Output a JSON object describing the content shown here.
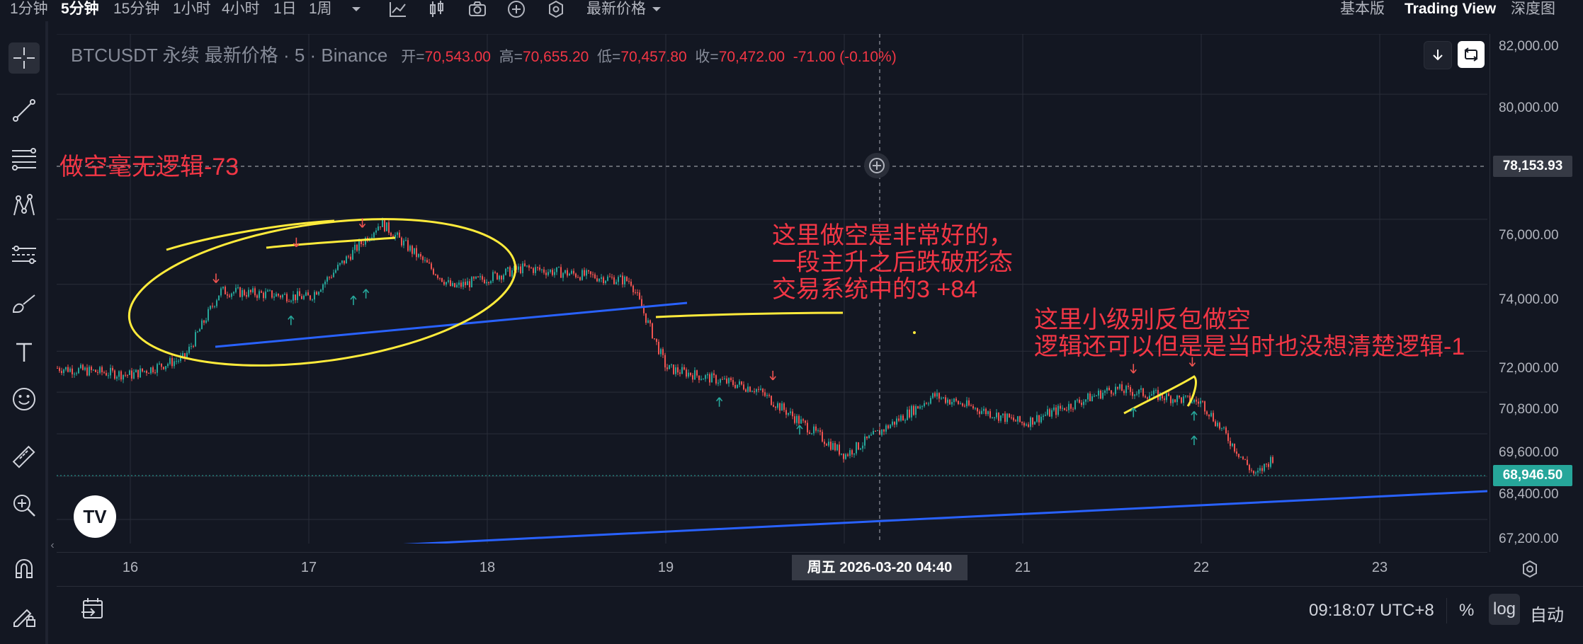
{
  "toolbar": {
    "intervals": [
      "1分钟",
      "5分钟",
      "15分钟",
      "1小时",
      "4小时",
      "1日",
      "1周"
    ],
    "active_interval": "5分钟",
    "price_type": "最新价格",
    "right_items": [
      "基本版",
      "Trading View",
      "深度图"
    ],
    "icons": [
      "chevron-down-icon",
      "indicators-icon",
      "candle-type-icon",
      "camera-icon",
      "add-icon",
      "settings-icon"
    ]
  },
  "left_tools": [
    "crosshair-icon",
    "trendline-icon",
    "fib-icon",
    "pattern-icon",
    "forecast-icon",
    "brush-icon",
    "text-icon",
    "emoji-icon",
    "ruler-icon",
    "zoom-in-icon",
    "magnet-icon",
    "lock-drawing-icon"
  ],
  "legend": {
    "symbol": "BTCUSDT 永续 最新价格 · 5 · Binance",
    "open_label": "开=",
    "open": "70,543.00",
    "high_label": "高=",
    "high": "70,655.20",
    "low_label": "低=",
    "low": "70,457.80",
    "close_label": "收=",
    "close": "70,472.00",
    "change": "-71.00 (-0.10%)"
  },
  "price_axis": {
    "ticks": [
      "82,000.00",
      "80,000.00",
      "76,000.00",
      "74,000.00",
      "72,000.00",
      "70,800.00",
      "69,600.00",
      "68,400.00",
      "67,200.00"
    ],
    "crosshair_price": "78,153.93",
    "last_price": "68,946.50"
  },
  "time_axis": {
    "ticks": [
      "16",
      "17",
      "18",
      "19",
      "21",
      "22",
      "23"
    ],
    "crosshair_label": "周五 2026-03-20   04:40"
  },
  "annotations": {
    "a1": "做空毫无逻辑-73",
    "a2_lines": [
      "这里做空是非常好的，",
      "一段主升之后跌破形态",
      "交易系统中的3 +84"
    ],
    "a3_lines": [
      "这里小级别反包做空",
      "逻辑还可以但是是当时也没想清楚逻辑-1"
    ]
  },
  "bottom_bar": {
    "clock": "09:18:07 UTC+8",
    "percent": "%",
    "log": "log",
    "auto": "自动"
  },
  "logo": "TV",
  "colors": {
    "background": "#131722",
    "grid": "#2a2e39",
    "up": "#26a69a",
    "down": "#ef5350",
    "annotation": "#f23645",
    "trendline": "#2962ff",
    "highlight": "#ffeb3b",
    "last_price": "#26a69a"
  },
  "chart_data": {
    "type": "candlestick",
    "symbol": "BTCUSDT",
    "interval": "5",
    "scale": "log",
    "ylim": [
      67000,
      82500
    ],
    "x_ticks": [
      "16",
      "17",
      "18",
      "19",
      "21",
      "22",
      "23"
    ],
    "approx_price_path": [
      {
        "x": "15",
        "y": 71800
      },
      {
        "x": "16",
        "y": 71300
      },
      {
        "x": "16.3",
        "y": 71800
      },
      {
        "x": "16.5",
        "y": 73800
      },
      {
        "x": "17",
        "y": 73600
      },
      {
        "x": "17.4",
        "y": 75900
      },
      {
        "x": "17.8",
        "y": 73900
      },
      {
        "x": "18.2",
        "y": 74500
      },
      {
        "x": "18.8",
        "y": 74100
      },
      {
        "x": "19",
        "y": 71500
      },
      {
        "x": "19.5",
        "y": 70900
      },
      {
        "x": "20",
        "y": 69000
      },
      {
        "x": "20.5",
        "y": 70700
      },
      {
        "x": "21",
        "y": 69900
      },
      {
        "x": "21.5",
        "y": 70900
      },
      {
        "x": "22",
        "y": 70500
      },
      {
        "x": "22.3",
        "y": 68400
      },
      {
        "x": "22.4",
        "y": 68950
      }
    ],
    "last_price": 68946.5,
    "crosshair_price": 78153.93
  }
}
